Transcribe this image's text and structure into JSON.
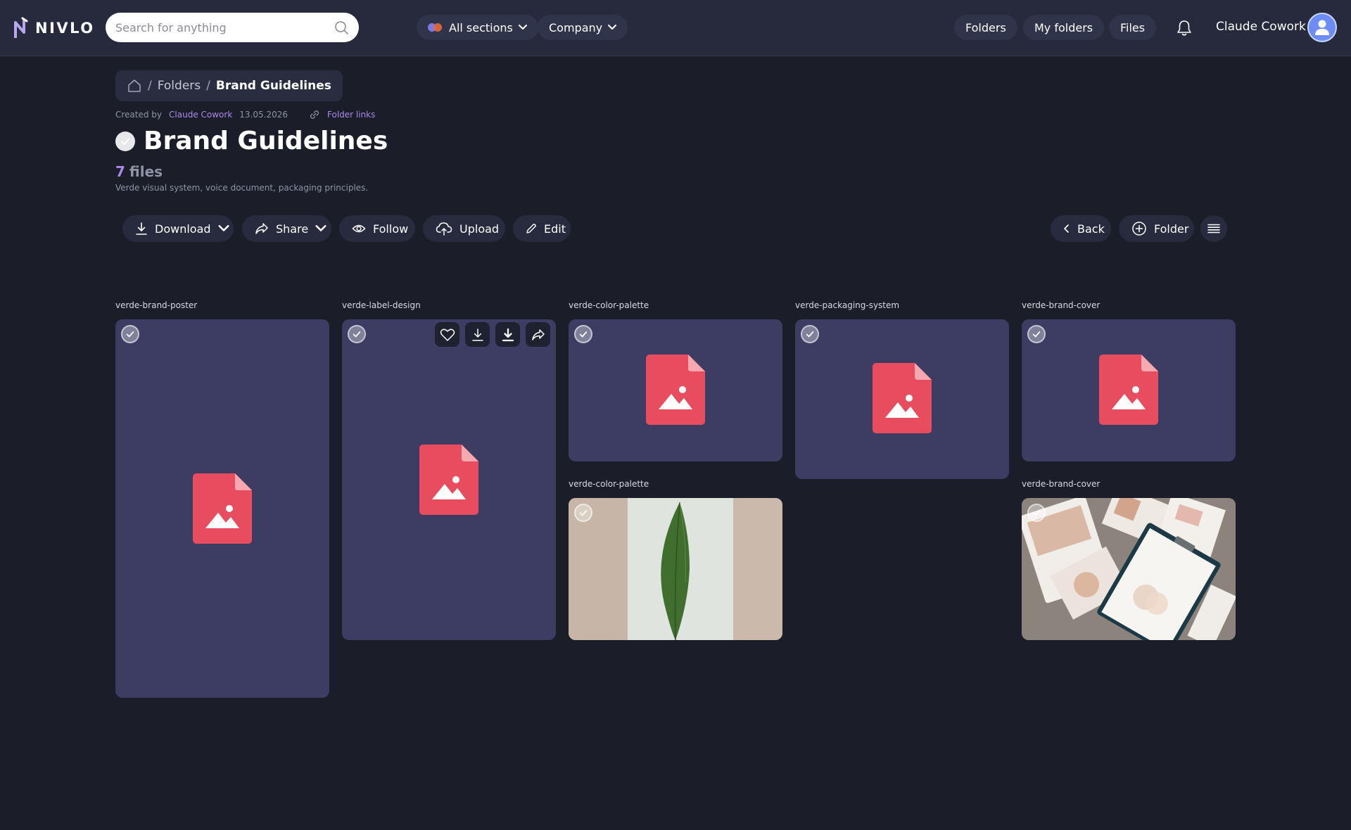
{
  "header": {
    "logo_text": "NIVLO",
    "search_placeholder": "Search for anything",
    "sections_label": "All sections",
    "company_label": "Company",
    "nav": [
      "Folders",
      "My folders",
      "Files"
    ],
    "user_name": "Claude Cowork"
  },
  "breadcrumb": {
    "items": [
      "Folders",
      "Brand Guidelines"
    ]
  },
  "meta": {
    "created_by_label": "Created by",
    "author": "Claude Cowork",
    "date": "13.05.2026",
    "folder_links_label": "Folder links"
  },
  "folder": {
    "title": "Brand Guidelines",
    "file_count": "7",
    "file_count_word": "files",
    "description": "Verde visual system, voice document, packaging principles."
  },
  "toolbar": {
    "download": "Download",
    "share": "Share",
    "follow": "Follow",
    "upload": "Upload",
    "edit": "Edit",
    "back": "Back",
    "folder": "Folder"
  },
  "files": [
    {
      "name": "verde-brand-poster",
      "thumb": "image-file-icon"
    },
    {
      "name": "verde-label-design",
      "thumb": "image-file-icon"
    },
    {
      "name": "verde-color-palette",
      "thumb": "image-file-icon"
    },
    {
      "name": "verde-packaging-system",
      "thumb": "image-file-icon"
    },
    {
      "name": "verde-brand-cover",
      "thumb": "image-file-icon"
    },
    {
      "name": "verde-color-palette",
      "thumb": "leaf-photo"
    },
    {
      "name": "verde-brand-cover",
      "thumb": "brand-mockup-photo"
    }
  ],
  "colors": {
    "background": "#1b1d29",
    "topbar": "#262a3c",
    "card": "#3d3d64",
    "accent": "#a98ae8",
    "file_icon": "#e84d5f"
  }
}
